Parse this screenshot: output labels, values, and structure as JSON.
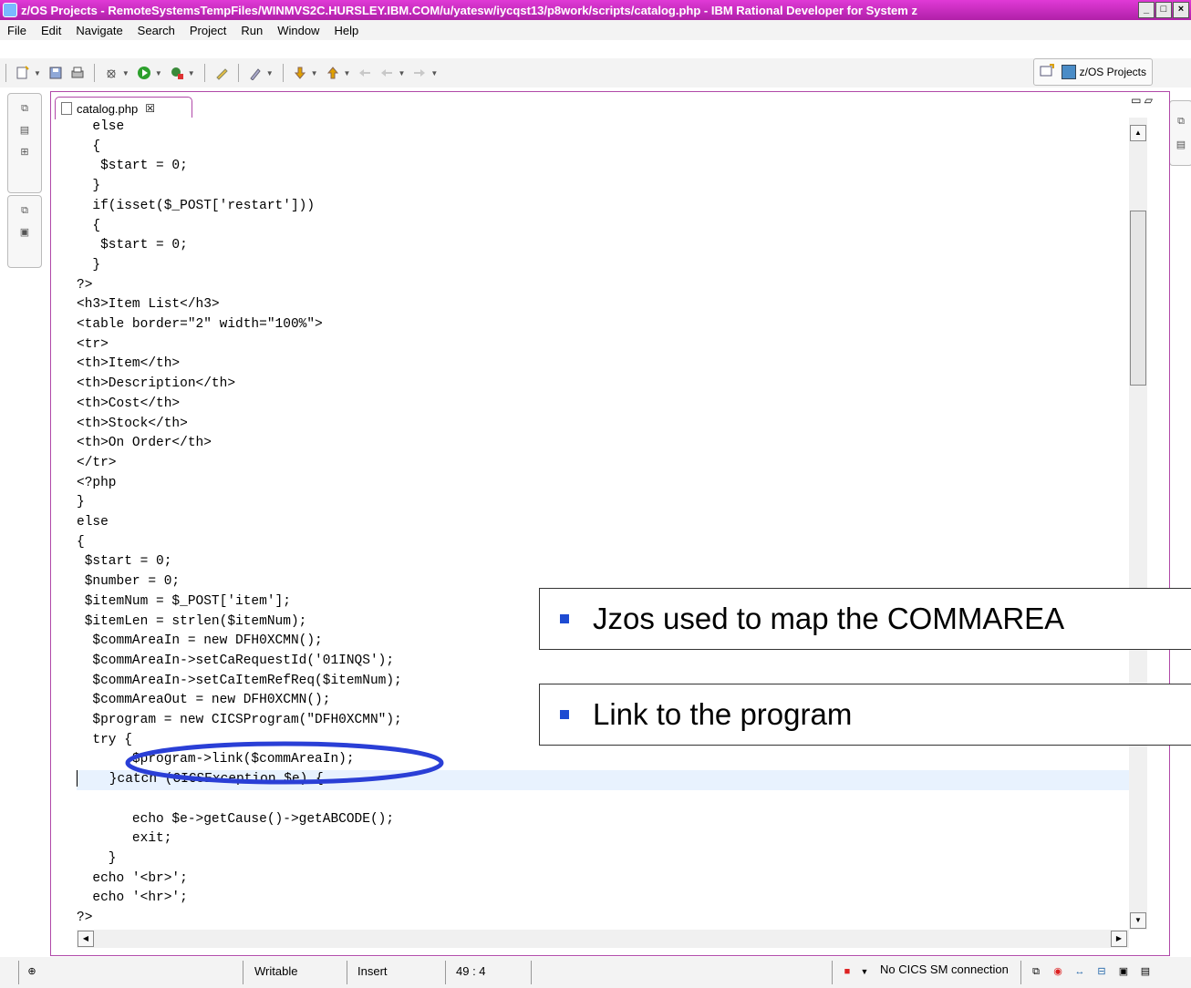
{
  "window": {
    "title": "z/OS Projects - RemoteSystemsTempFiles/WINMVS2C.HURSLEY.IBM.COM/u/yatesw/iycqst13/p8work/scripts/catalog.php - IBM Rational Developer for System z",
    "minimize_glyph": "_",
    "maximize_glyph": "□",
    "close_glyph": "×"
  },
  "menu": [
    "File",
    "Edit",
    "Navigate",
    "Search",
    "Project",
    "Run",
    "Window",
    "Help"
  ],
  "toolbar": {
    "perspective_label": "z/OS Projects"
  },
  "editor": {
    "tab_label": "catalog.php",
    "tab_close": "☒",
    "minmax": "▭ ▱",
    "lines": [
      "  else",
      "  {",
      "   $start = 0;",
      "  }",
      "  if(isset($_POST['restart']))",
      "  {",
      "   $start = 0;",
      "  }",
      "?>",
      "<h3>Item List</h3>",
      "<table border=\"2\" width=\"100%\">",
      "<tr>",
      "<th>Item</th>",
      "<th>Description</th>",
      "<th>Cost</th>",
      "<th>Stock</th>",
      "<th>On Order</th>",
      "</tr>",
      "<?php",
      "}",
      "else",
      "{",
      " $start = 0;",
      " $number = 0;",
      " $itemNum = $_POST['item'];",
      " $itemLen = strlen($itemNum);",
      "  $commAreaIn = new DFH0XCMN();",
      "  $commAreaIn->setCaRequestId('01INQS');",
      "  $commAreaIn->setCaItemRefReq($itemNum);",
      "  $commAreaOut = new DFH0XCMN();",
      "  $program = new CICSProgram(\"DFH0XCMN\");",
      "  try {",
      "       $program->link($commAreaIn);",
      "    }catch (CICSException $e) {",
      "",
      "       echo $e->getCause()->getABCODE();",
      "       exit;",
      "    }",
      "  echo '<br>';",
      "  echo '<hr>';",
      "?>"
    ]
  },
  "callouts": {
    "commarea": "Jzos used to map the COMMAREA",
    "link": "Link to the program"
  },
  "status": {
    "writable": "Writable",
    "insert": "Insert",
    "position": "49 : 4",
    "cics": "No CICS SM connection"
  },
  "colors": {
    "title_bar": "#c62ec0",
    "panel_border": "#b048a8",
    "callout_bullet": "#1e4bd2",
    "highlight_ellipse": "#2a3fd6",
    "current_line": "#e8f2fe"
  }
}
